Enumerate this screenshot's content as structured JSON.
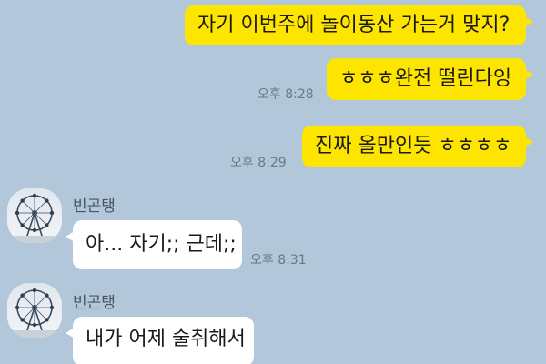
{
  "messages": [
    {
      "text": "자기 이번주에 놀이동산 가는거 맞지?"
    },
    {
      "text": "ㅎㅎㅎ완전 떨린다잉",
      "time": "오후 8:28"
    },
    {
      "text": "진짜 올만인듯 ㅎㅎㅎㅎ",
      "time": "오후 8:29"
    },
    {
      "sender": "빈곤탱",
      "text": "아... 자기;; 근데;;",
      "time": "오후 8:31"
    },
    {
      "sender": "빈곤탱",
      "text": "내가 어제 술취해서"
    }
  ],
  "contact": {
    "avatar_icon": "ferris-wheel-icon"
  },
  "colors": {
    "background": "#b2c7d9",
    "my_bubble": "#fee500",
    "their_bubble": "#ffffff"
  }
}
